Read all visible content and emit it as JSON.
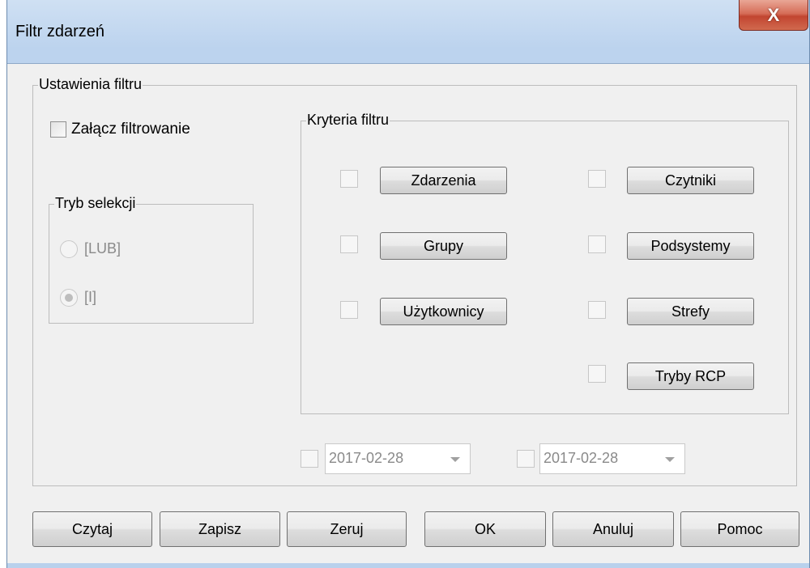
{
  "window": {
    "title": "Filtr zdarzeń",
    "close_label": "X"
  },
  "settings_group": {
    "label": "Ustawienia filtru"
  },
  "enable_filter": {
    "label": "Załącz filtrowanie",
    "checked": false
  },
  "selection_mode": {
    "label": "Tryb selekcji",
    "options": [
      {
        "label": "[LUB]",
        "selected": false,
        "enabled": false
      },
      {
        "label": "[I]",
        "selected": true,
        "enabled": false
      }
    ]
  },
  "criteria_group": {
    "label": "Kryteria filtru",
    "items": [
      {
        "label": "Zdarzenia",
        "checked": false
      },
      {
        "label": "Czytniki",
        "checked": false
      },
      {
        "label": "Grupy",
        "checked": false
      },
      {
        "label": "Podsystemy",
        "checked": false
      },
      {
        "label": "Użytkownicy",
        "checked": false
      },
      {
        "label": "Strefy",
        "checked": false
      },
      {
        "label": "Tryby RCP",
        "checked": false
      }
    ]
  },
  "date_from": {
    "value": "2017-02-28",
    "checked": false
  },
  "date_to": {
    "value": "2017-02-28",
    "checked": false
  },
  "buttons": {
    "read": "Czytaj",
    "save": "Zapisz",
    "reset": "Zeruj",
    "ok": "OK",
    "cancel": "Anuluj",
    "help": "Pomoc"
  }
}
